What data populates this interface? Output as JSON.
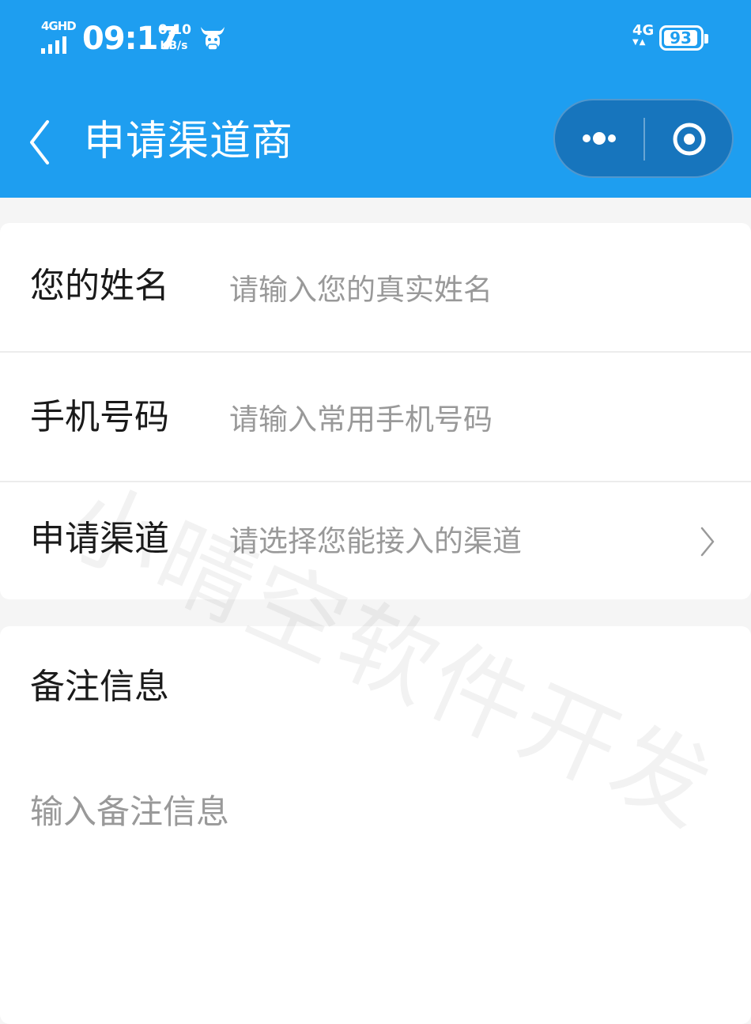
{
  "status_bar": {
    "network_left": "4GHD",
    "time": "09:17",
    "speed_value": "0.10",
    "speed_unit": "KB/s",
    "network_right": "4G",
    "battery": "93",
    "app_icon": "ox-head-icon"
  },
  "nav": {
    "title": "申请渠道商",
    "back_icon": "chevron-left-icon",
    "more_icon": "more-dots-icon",
    "close_icon": "target-close-icon"
  },
  "form": {
    "name": {
      "label": "您的姓名",
      "placeholder": "请输入您的真实姓名"
    },
    "phone": {
      "label": "手机号码",
      "placeholder": "请输入常用手机号码"
    },
    "channel": {
      "label": "申请渠道",
      "placeholder": "请选择您能接入的渠道"
    },
    "notes": {
      "label": "备注信息",
      "placeholder": "输入备注信息"
    }
  },
  "watermark": "小晴空软件开发",
  "colors": {
    "primary": "#1e9ef0",
    "capsule": "#1775bd",
    "background": "#f5f5f5",
    "placeholder": "#999999"
  }
}
